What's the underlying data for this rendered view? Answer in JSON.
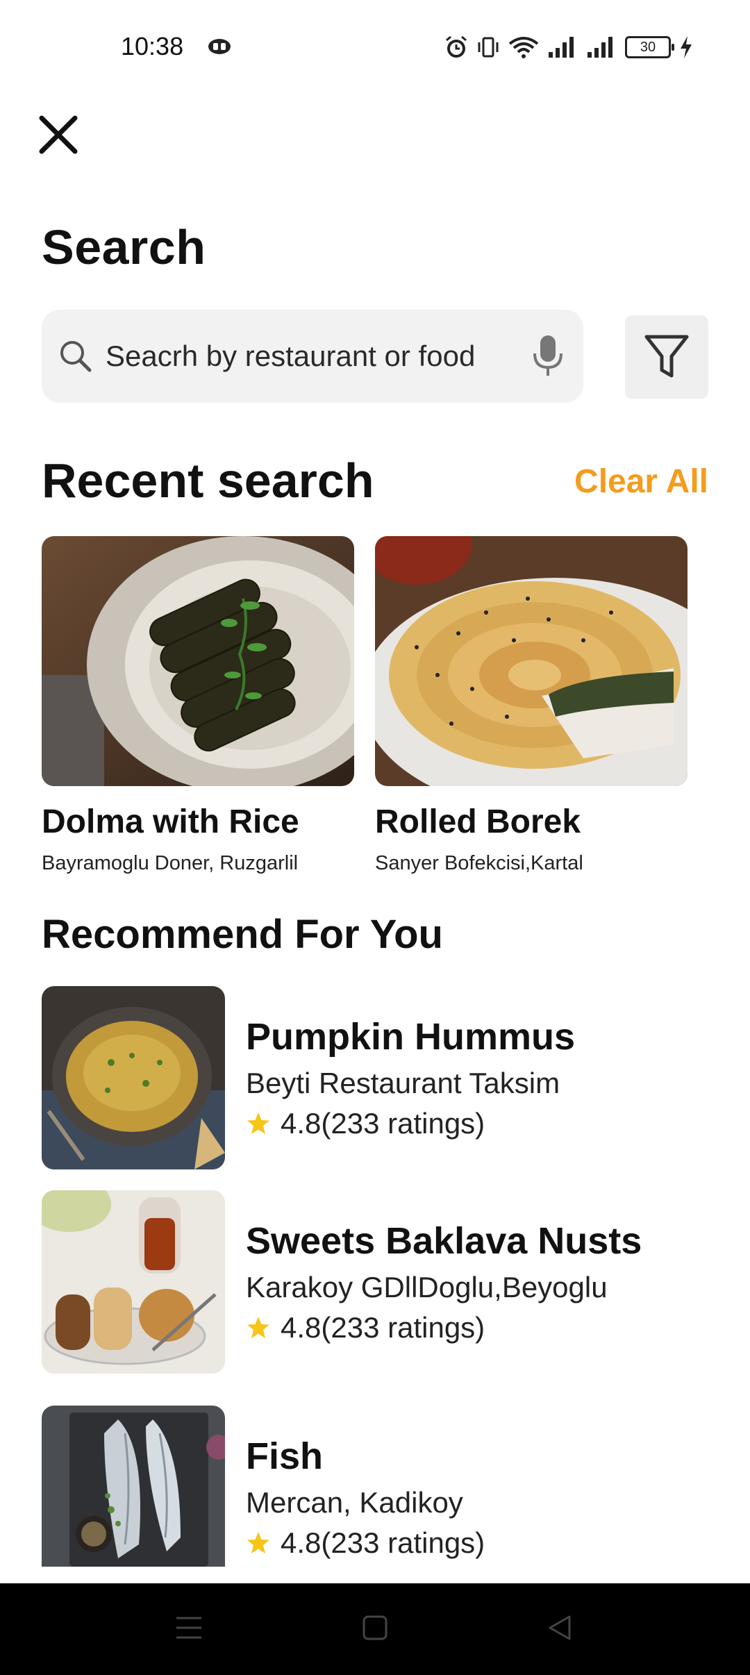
{
  "status_bar": {
    "time": "10:38",
    "battery": "30",
    "icons": [
      "alarm-icon",
      "vibrate-icon",
      "wifi-icon",
      "signal-icon",
      "signal-icon",
      "battery-icon",
      "charging-icon"
    ]
  },
  "header": {
    "title": "Search"
  },
  "search": {
    "placeholder": "Seacrh by restaurant or food"
  },
  "recent": {
    "title": "Recent search",
    "clear_label": "Clear All",
    "items": [
      {
        "name": "Dolma with Rice",
        "place": "Bayramoglu Doner, Ruzgarlil"
      },
      {
        "name": "Rolled Borek",
        "place": "Sanyer Bofekcisi,Kartal"
      }
    ]
  },
  "recommend": {
    "title": "Recommend For You",
    "items": [
      {
        "name": "Pumpkin Hummus",
        "place": "Beyti Restaurant Taksim",
        "rating": "4.8(233 ratings)"
      },
      {
        "name": "Sweets Baklava Nusts",
        "place": "Karakoy GDllDoglu,Beyoglu",
        "rating": "4.8(233 ratings)"
      },
      {
        "name": "Fish",
        "place": "Mercan, Kadikoy",
        "rating": "4.8(233 ratings)"
      }
    ]
  },
  "colors": {
    "accent": "#f39c1d",
    "star": "#f5c518"
  }
}
